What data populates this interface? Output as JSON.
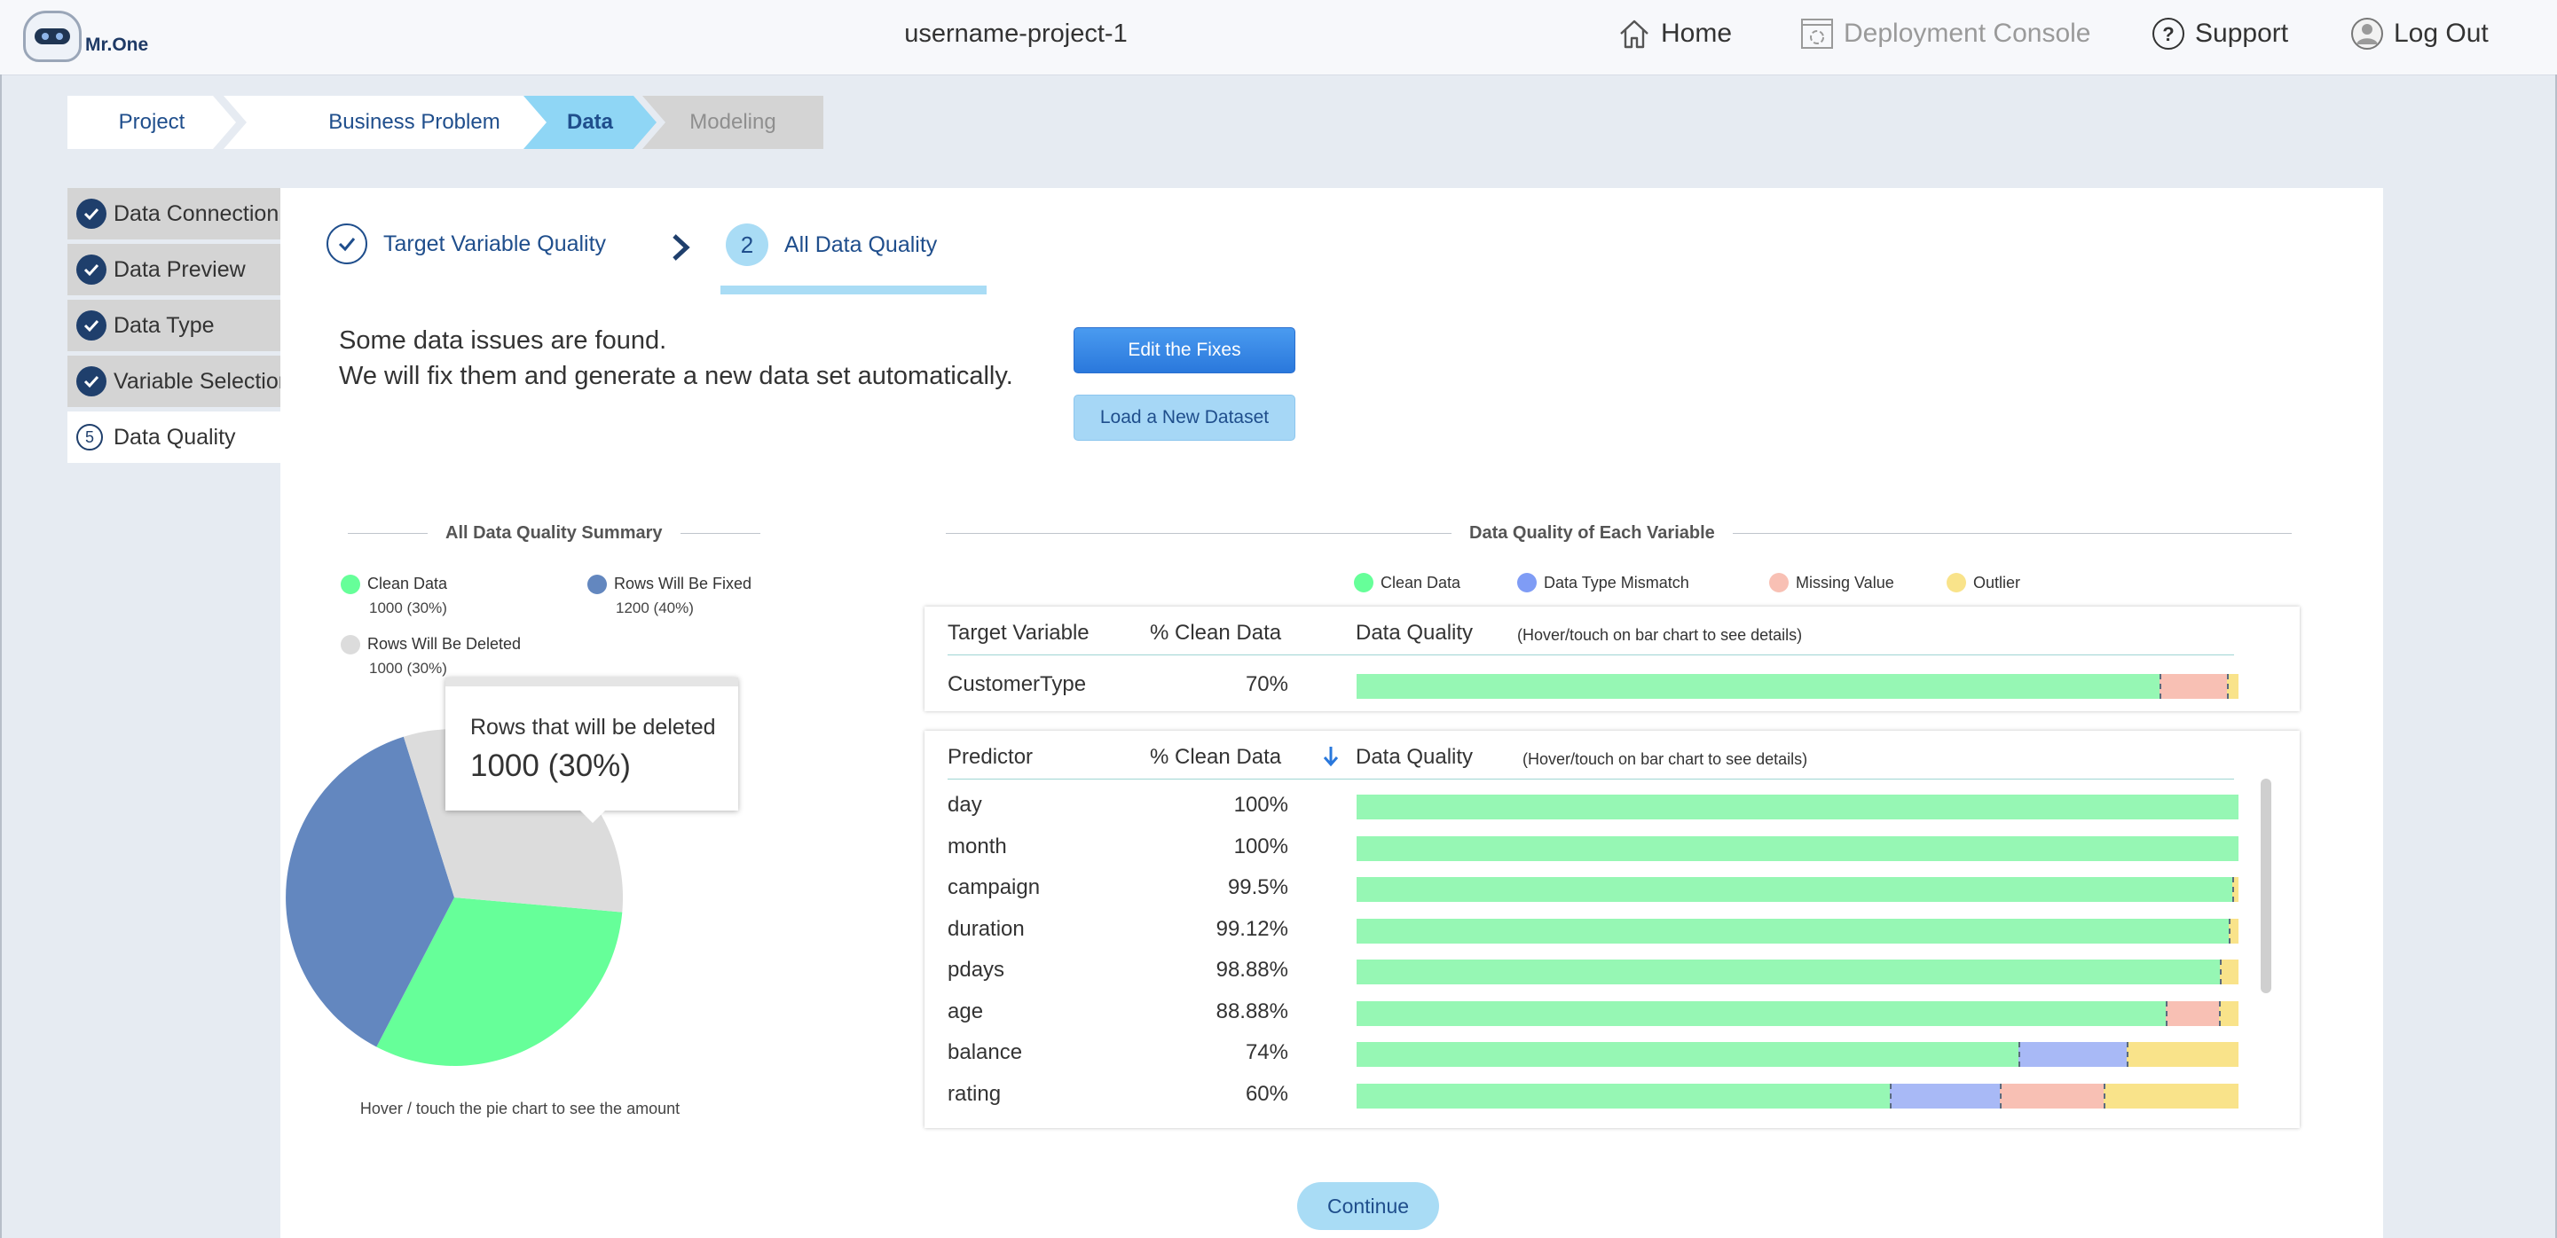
{
  "header": {
    "brand": "Mr.One",
    "project_name": "username-project-1",
    "nav": {
      "home": "Home",
      "deployment": "Deployment Console",
      "support": "Support",
      "logout": "Log Out"
    }
  },
  "breadcrumb": [
    "Project",
    "Business Problem",
    "Data",
    "Modeling"
  ],
  "side_steps": {
    "s1": "Data Connection",
    "s2": "Data Preview",
    "s3": "Data Type",
    "s4": "Variable Selection",
    "s5_num": "5",
    "s5": "Data Quality"
  },
  "substeps": {
    "first": "Target Variable Quality",
    "second_num": "2",
    "second": "All Data Quality"
  },
  "issues": {
    "line1": "Some data issues are found.",
    "line2": "We will fix them and generate a new data set automatically."
  },
  "buttons": {
    "edit": "Edit the Fixes",
    "load": "Load a New Dataset",
    "continue": "Continue"
  },
  "summary": {
    "title": "All Data Quality Summary",
    "legend": {
      "clean_label": "Clean Data",
      "clean_value": "1000 (30%)",
      "fixed_label": "Rows Will Be Fixed",
      "fixed_value": "1200 (40%)",
      "deleted_label": "Rows Will Be Deleted",
      "deleted_value": "1000 (30%)"
    },
    "tooltip": {
      "label": "Rows that will be deleted",
      "value": "1000 (30%)"
    },
    "note": "Hover / touch the pie chart to see the amount"
  },
  "colors": {
    "clean": "#66ff99",
    "fixed": "#6387bf",
    "deleted": "#dcdcdc",
    "bar_clean": "#96f7b4",
    "bar_mismatch": "#a8b9f6",
    "bar_missing": "#f8c0b4",
    "bar_outlier": "#f9e38a",
    "legend_clean": "#66ff99",
    "legend_mismatch": "#7f9cf5",
    "legend_missing": "#f8c0b4",
    "legend_outlier": "#f9e38a"
  },
  "variables": {
    "title": "Data Quality of Each Variable",
    "legend": {
      "clean": "Clean Data",
      "mismatch": "Data Type Mismatch",
      "missing": "Missing Value",
      "outlier": "Outlier"
    },
    "target_header": {
      "col1": "Target Variable",
      "col2": "% Clean Data",
      "col3": "Data Quality",
      "note": "(Hover/touch on bar chart to see details)"
    },
    "predictor_header": {
      "col1": "Predictor",
      "col2": "% Clean Data",
      "col3": "Data Quality",
      "note": "(Hover/touch on bar chart to see details)"
    }
  },
  "chart_data": [
    {
      "type": "pie",
      "title": "All Data Quality Summary",
      "labels": [
        "Clean Data",
        "Rows Will Be Fixed",
        "Rows Will Be Deleted"
      ],
      "values": [
        1000,
        1200,
        1000
      ],
      "percent_labels": [
        "30%",
        "40%",
        "30%"
      ]
    },
    {
      "type": "bar",
      "title": "Data Quality of Each Variable",
      "stacked": true,
      "orientation": "horizontal",
      "series_names": [
        "Clean Data",
        "Data Type Mismatch",
        "Missing Value",
        "Outlier"
      ],
      "target": [
        {
          "name": "CustomerType",
          "clean_pct_label": "70%",
          "segments": [
            91,
            0,
            7.7,
            1.3
          ]
        }
      ],
      "predictors": [
        {
          "name": "day",
          "clean_pct_label": "100%",
          "segments": [
            100,
            0,
            0,
            0
          ]
        },
        {
          "name": "month",
          "clean_pct_label": "100%",
          "segments": [
            100,
            0,
            0,
            0
          ]
        },
        {
          "name": "campaign",
          "clean_pct_label": "99.5%",
          "segments": [
            99.3,
            0,
            0,
            0.7
          ]
        },
        {
          "name": "duration",
          "clean_pct_label": "99.12%",
          "segments": [
            98.9,
            0,
            0,
            1.1
          ]
        },
        {
          "name": "pdays",
          "clean_pct_label": "98.88%",
          "segments": [
            97.9,
            0,
            0,
            2.1
          ]
        },
        {
          "name": "age",
          "clean_pct_label": "88.88%",
          "segments": [
            91.8,
            0,
            6.0,
            2.2
          ]
        },
        {
          "name": "balance",
          "clean_pct_label": "74%",
          "segments": [
            75,
            12.3,
            0,
            12.7
          ]
        },
        {
          "name": "rating",
          "clean_pct_label": "60%",
          "segments": [
            60.5,
            12.4,
            11.8,
            15.3
          ]
        }
      ]
    }
  ]
}
